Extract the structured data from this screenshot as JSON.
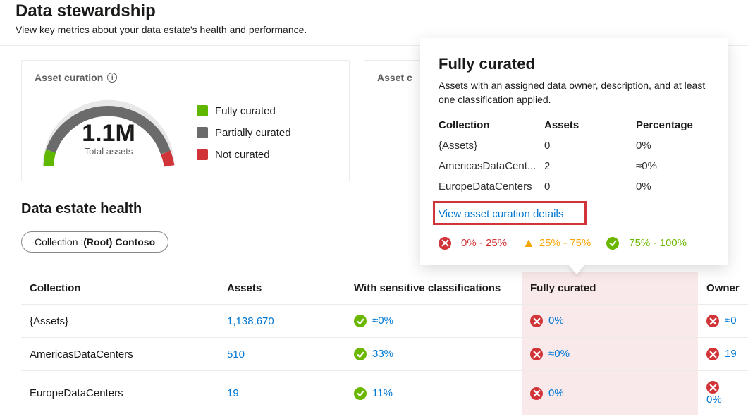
{
  "page": {
    "title": "Data stewardship",
    "subtitle": "View key metrics about your data estate's health and performance."
  },
  "chart_data": {
    "type": "pie",
    "title": "Asset curation",
    "series": [
      {
        "name": "Fully curated",
        "pct": 0,
        "color": "#5fb700"
      },
      {
        "name": "Partially curated",
        "pct": 95,
        "color": "#6b6b6b"
      },
      {
        "name": "Not curated",
        "pct": 5,
        "color": "#d13438"
      }
    ],
    "center_value": "1.1M",
    "center_label": "Total assets"
  },
  "cards": {
    "card1_title": "Asset curation",
    "card2_title": "Asset c",
    "legend": {
      "fully": "Fully curated",
      "partially": "Partially curated",
      "not": "Not curated"
    },
    "gauge": {
      "value": "1.1M",
      "label": "Total assets",
      "colors": {
        "fully": "#5fb700",
        "partially": "#6b6b6b",
        "not": "#d13438"
      }
    }
  },
  "health": {
    "section_title": "Data estate health",
    "pill_label": "Collection : ",
    "pill_value": "(Root) Contoso",
    "columns": {
      "collection": "Collection",
      "assets": "Assets",
      "sensitive": "With sensitive classifications",
      "fully": "Fully curated",
      "owner": "Owner"
    },
    "rows": [
      {
        "collection": "{Assets}",
        "assets": "1,138,670",
        "sensitive": "≈0%",
        "sensitive_status": "green",
        "fully": "0%",
        "fully_status": "red",
        "owner": "≈0",
        "owner_status": "red"
      },
      {
        "collection": "AmericasDataCenters",
        "assets": "510",
        "sensitive": "33%",
        "sensitive_status": "green",
        "fully": "≈0%",
        "fully_status": "red",
        "owner": "19",
        "owner_status": "red"
      },
      {
        "collection": "EuropeDataCenters",
        "assets": "19",
        "sensitive": "11%",
        "sensitive_status": "green",
        "fully": "0%",
        "fully_status": "red",
        "owner": "0%",
        "owner_status": "red"
      }
    ]
  },
  "flyout": {
    "title": "Fully curated",
    "description": "Assets with an assigned data owner, description, and at least one classification applied.",
    "cols": {
      "c1": "Collection",
      "c2": "Assets",
      "c3": "Percentage"
    },
    "rows": [
      {
        "c1": "{Assets}",
        "c2": "0",
        "c3": "0%"
      },
      {
        "c1": "AmericasDataCent...",
        "c2": "2",
        "c3": "≈0%"
      },
      {
        "c1": "EuropeDataCenters",
        "c2": "0",
        "c3": "0%"
      }
    ],
    "link": "View asset curation details",
    "legend": {
      "low": "0% - 25%",
      "mid": "25% - 75%",
      "high": "75% - 100%"
    }
  }
}
